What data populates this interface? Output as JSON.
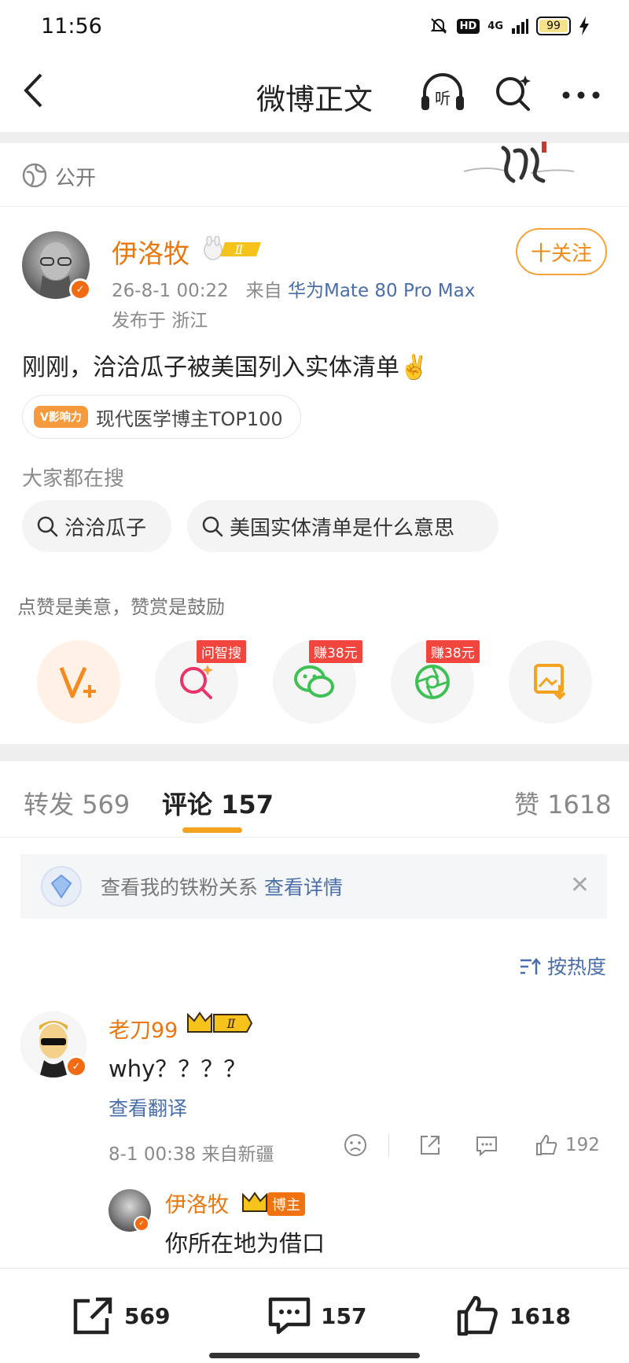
{
  "status_bar": {
    "time": "11:56",
    "network": "4G",
    "battery": "99"
  },
  "nav": {
    "title": "微博正文"
  },
  "visibility": {
    "label": "公开"
  },
  "post": {
    "author": "伊洛牧",
    "level_badge": "Ⅱ",
    "time": "26-8-1 00:22",
    "from_prefix": "来自",
    "device": "华为Mate 80 Pro Max",
    "location": "发布于 浙江",
    "follow_label": "十关注",
    "text": "刚刚，洽洽瓜子被美国列入实体清单✌️",
    "influence_chip": "V影响力",
    "influence_text": "现代医学博主TOP100"
  },
  "search": {
    "heading": "大家都在搜",
    "chips": [
      "洽洽瓜子",
      "美国实体清单是什么意思"
    ]
  },
  "reward": {
    "tip": "点赞是美意，赞赏是鼓励",
    "badges": [
      "问智搜",
      "赚38元",
      "赚38元"
    ]
  },
  "tabs": {
    "repost_label": "转发",
    "repost_count": "569",
    "comment_label": "评论",
    "comment_count": "157",
    "like_label": "赞",
    "like_count": "1618"
  },
  "fan_banner": {
    "text": "查看我的铁粉关系",
    "link": "查看详情"
  },
  "sort": {
    "label": "按热度"
  },
  "comment": {
    "author": "老刀99",
    "level": "Ⅱ",
    "text": "why？？？？",
    "translate": "查看翻译",
    "meta": "8-1 00:38  来自新疆",
    "likes": "192"
  },
  "reply": {
    "author": "伊洛牧",
    "chip": "博主",
    "text": "你所在地为借口"
  },
  "bottom_bar": {
    "reposts": "569",
    "comments": "157",
    "likes": "1618"
  },
  "colors": {
    "accent_orange": "#e8770f",
    "link_blue": "#4a6ea9",
    "badge_red": "#f2453d",
    "tab_underline": "#f3a31f"
  }
}
